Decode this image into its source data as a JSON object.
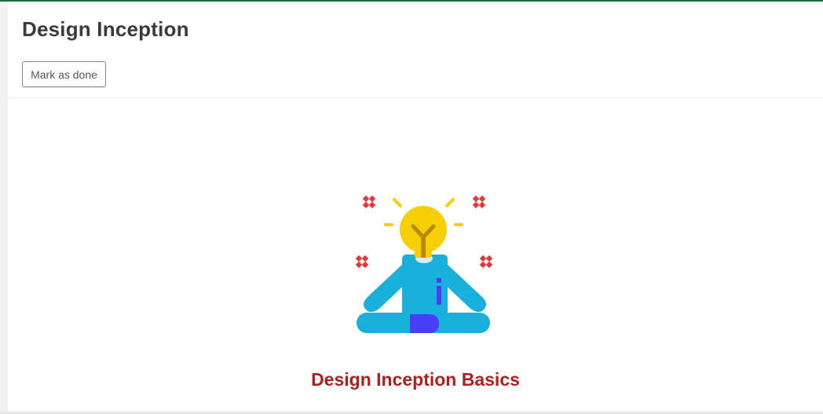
{
  "page": {
    "title": "Design Inception",
    "mark_done_label": "Mark as done"
  },
  "content": {
    "illustration_icon": "meditating-person-lightbulb-icon",
    "heading": "Design Inception Basics"
  },
  "colors": {
    "accent_bar": "#1e6b3a",
    "title_text": "#3b3b3b",
    "heading_red": "#b01e1e",
    "bulb_yellow": "#f6cf06",
    "body_cyan": "#1ab0dc",
    "info_blue": "#4b3cf5",
    "sparkle_red": "#e03a3a"
  }
}
